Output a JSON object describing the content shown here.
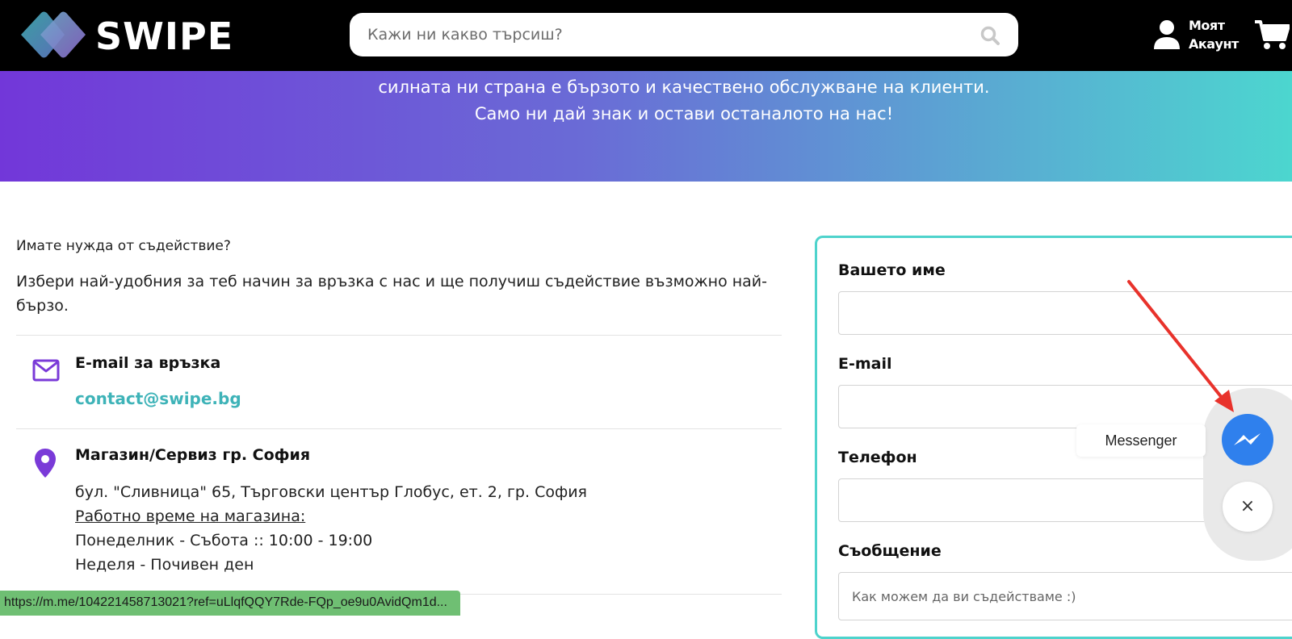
{
  "header": {
    "logo_text": "SWIPE",
    "search_placeholder": "Кажи ни какво търсиш?",
    "account_line1": "Моят",
    "account_line2": "Акаунт"
  },
  "banner": {
    "line1": "силната ни страна е бързото и качествено обслужване на клиенти.",
    "line2": "Само ни дай знак и остави останалото на нас!"
  },
  "contact": {
    "intro_small": "Имате нужда от съдействие?",
    "intro_text": "Избери най-удобния за теб начин за връзка с нас и ще получиш съдействие възможно най-бързо.",
    "email": {
      "title": "E-mail за връзка",
      "address": "contact@swipe.bg"
    },
    "store": {
      "title": "Магазин/Сервиз гр. София",
      "address": "бул. \"Сливница\" 65, Търговски център Глобус, ет. 2, гр. София",
      "hours_label": "Работно време на магазина:",
      "hours_week": "Понеделник - Събота :: 10:00 - 19:00",
      "hours_sunday": "Неделя - Почивен ден"
    }
  },
  "form": {
    "name_label": "Вашето име",
    "email_label": "E-mail",
    "phone_label": "Телефон",
    "message_label": "Съобщение",
    "message_placeholder": "Как можем да ви съдействаме :)"
  },
  "messenger": {
    "tooltip": "Messenger",
    "close_glyph": "×"
  },
  "status_bar": {
    "url": "https://m.me/104221458713021?ref=uLlqfQQY7Rde-FQp_oe9u0AvidQm1d..."
  },
  "colors": {
    "accent_teal": "#4ed3cc",
    "link_teal": "#3eb3b8",
    "icon_purple": "#7a3ad8",
    "messenger_blue": "#2f80ed",
    "annotation_red": "#e8322b"
  }
}
